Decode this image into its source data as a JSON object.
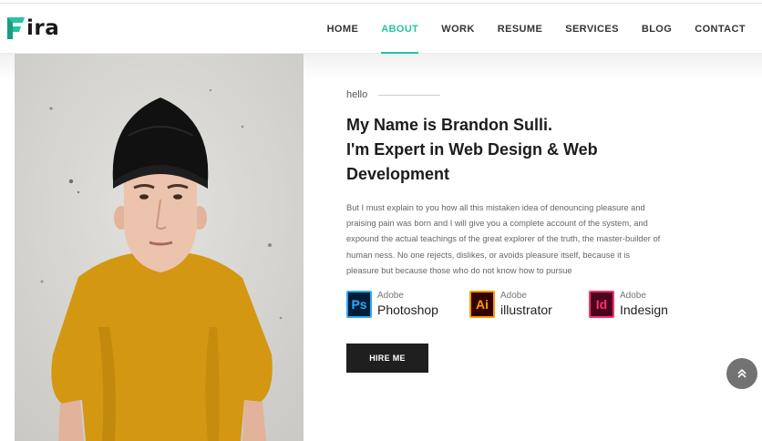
{
  "brand": {
    "logo_text": "ira",
    "accent": "#26c4a5"
  },
  "nav": {
    "items": [
      {
        "label": "HOME",
        "active": false
      },
      {
        "label": "ABOUT",
        "active": true
      },
      {
        "label": "WORK",
        "active": false
      },
      {
        "label": "RESUME",
        "active": false
      },
      {
        "label": "SERVICES",
        "active": false
      },
      {
        "label": "BLOG",
        "active": false
      },
      {
        "label": "CONTACT",
        "active": false
      }
    ]
  },
  "about": {
    "greeting": "hello",
    "headline": [
      "My Name is Brandon Sulli.",
      "I'm Expert in Web Design & Web",
      "Development"
    ],
    "description": "But I must explain to you how all this mistaken idea of denouncing pleasure and praising pain was born and I will give you a complete account of the system, and expound the actual teachings of the great explorer of the truth, the master-builder of human ness. No one rejects, dislikes, or avoids pleasure itself, because it is pleasure but because those who do not know how to pursue",
    "skills": [
      {
        "icon_text": "Ps",
        "vendor": "Adobe",
        "name": "Photoshop",
        "icon": "photoshop-icon",
        "color": "#31a8ff",
        "bg": "#001e36"
      },
      {
        "icon_text": "Ai",
        "vendor": "Adobe",
        "name": "illustrator",
        "icon": "illustrator-icon",
        "color": "#ff9a00",
        "bg": "#330000"
      },
      {
        "icon_text": "Id",
        "vendor": "Adobe",
        "name": "Indesign",
        "icon": "indesign-icon",
        "color": "#ff3366",
        "bg": "#49021f"
      }
    ],
    "cta_label": "HIRE ME"
  },
  "icons": {
    "scroll_top": "double-chevron-up-icon",
    "photo": "profile-photo"
  }
}
